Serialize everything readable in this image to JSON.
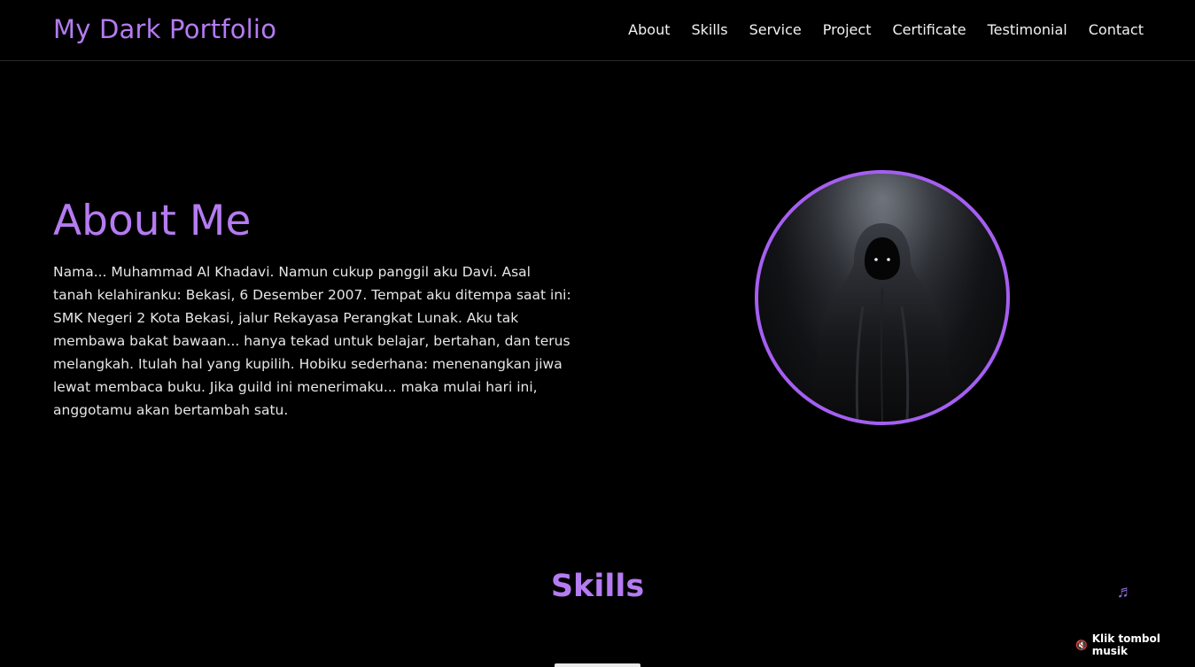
{
  "brand": {
    "title": "My Dark Portfolio"
  },
  "nav": {
    "items": [
      {
        "label": "About"
      },
      {
        "label": "Skills"
      },
      {
        "label": "Service"
      },
      {
        "label": "Project"
      },
      {
        "label": "Certificate"
      },
      {
        "label": "Testimonial"
      },
      {
        "label": "Contact"
      }
    ]
  },
  "about": {
    "title": "About Me",
    "text": "Nama... Muhammad Al Khadavi. Namun cukup panggil aku Davi. Asal tanah kelahiranku: Bekasi, 6 Desember 2007. Tempat aku ditempa saat ini: SMK Negeri 2 Kota Bekasi, jalur Rekayasa Perangkat Lunak. Aku tak membawa bakat bawaan... hanya tekad untuk belajar, bertahan, dan terus melangkah. Itulah hal yang kupilih. Hobiku sederhana: menenangkan jiwa lewat membaca buku. Jika guild ini menerimaku... maka mulai hari ini, anggotamu akan bertambah satu.",
    "portrait_icon": "hooded-figure"
  },
  "skills": {
    "title": "Skills"
  },
  "music": {
    "icon": "music-note-icon",
    "hint": "Klik tombol musik",
    "hint_icon": "speaker-muted-icon"
  },
  "colors": {
    "accent": "#b57bf1",
    "portrait_border": "#a55ff0",
    "background": "#000000"
  }
}
